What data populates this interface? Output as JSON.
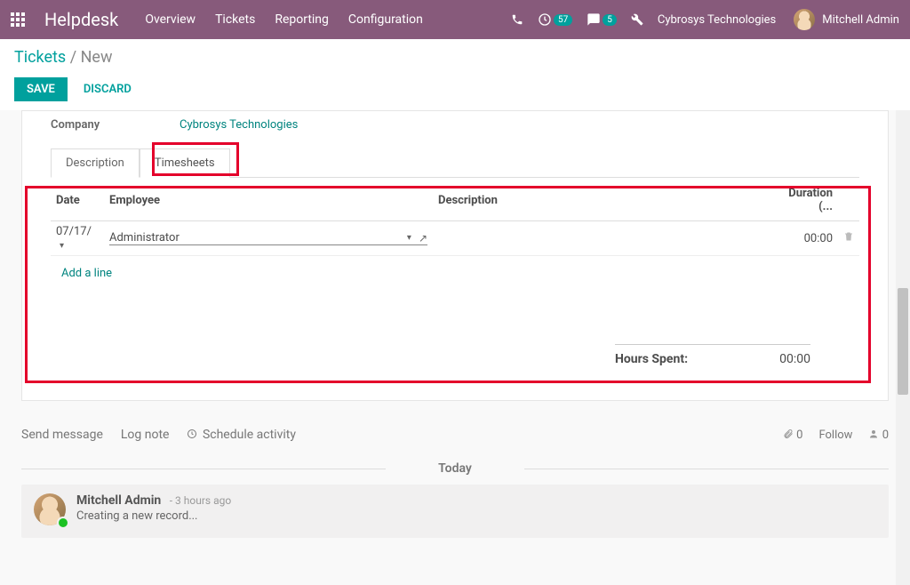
{
  "navbar": {
    "brand": "Helpdesk",
    "links": [
      "Overview",
      "Tickets",
      "Reporting",
      "Configuration"
    ],
    "activity_badge": "57",
    "chat_badge": "5",
    "company": "Cybrosys Technologies",
    "user": "Mitchell Admin"
  },
  "breadcrumb": {
    "root": "Tickets",
    "sep": "/",
    "current": "New"
  },
  "actions": {
    "save": "Save",
    "discard": "Discard"
  },
  "form": {
    "company_label": "Company",
    "company_value": "Cybrosys Technologies",
    "tabs": {
      "description": "Description",
      "timesheets": "Timesheets",
      "active": "timesheets"
    }
  },
  "timesheet": {
    "headers": {
      "date": "Date",
      "employee": "Employee",
      "description": "Description",
      "duration": "Duration (..."
    },
    "rows": [
      {
        "date": "07/17/",
        "employee": "Administrator",
        "description": "",
        "duration": "00:00"
      }
    ],
    "add_line": "Add a line",
    "summary_label": "Hours Spent:",
    "summary_value": "00:00"
  },
  "chatter": {
    "send": "Send message",
    "log": "Log note",
    "schedule": "Schedule activity",
    "attach_count": "0",
    "follow": "Follow",
    "follower_count": "0",
    "separator": "Today",
    "msg": {
      "author": "Mitchell Admin",
      "time": "- 3 hours ago",
      "body": "Creating a new record..."
    }
  }
}
